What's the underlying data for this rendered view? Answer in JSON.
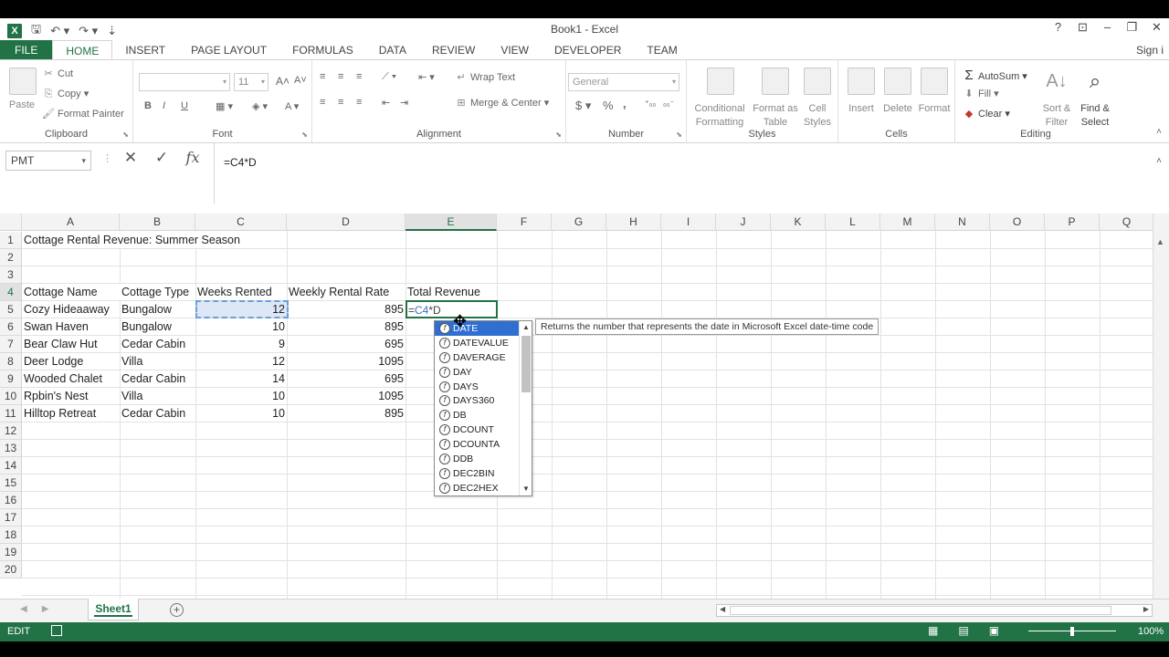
{
  "window": {
    "title": "Book1 - Excel",
    "sign_in": "Sign i",
    "help": "?",
    "minimize": "–",
    "restore": "❐",
    "close": "✕"
  },
  "ribbon_tabs": [
    "FILE",
    "HOME",
    "INSERT",
    "PAGE LAYOUT",
    "FORMULAS",
    "DATA",
    "REVIEW",
    "VIEW",
    "DEVELOPER",
    "TEAM"
  ],
  "active_tab": "HOME",
  "ribbon": {
    "clipboard": {
      "label": "Clipboard",
      "paste": "Paste",
      "cut": "Cut",
      "copy": "Copy",
      "format_painter": "Format Painter"
    },
    "font": {
      "label": "Font",
      "font_size": "11",
      "bold": "B",
      "italic": "I",
      "underline": "U",
      "font_grow": "A",
      "font_shrink": "A"
    },
    "alignment": {
      "label": "Alignment",
      "wrap_text": "Wrap Text",
      "merge_center": "Merge & Center"
    },
    "number": {
      "label": "Number",
      "format": "General",
      "currency": "$",
      "percent": "%",
      "comma": ","
    },
    "styles": {
      "label": "Styles",
      "conditional": "Conditional Formatting",
      "format_table": "Format as Table",
      "cell_styles": "Cell Styles"
    },
    "cells": {
      "label": "Cells",
      "insert": "Insert",
      "delete": "Delete",
      "format": "Format"
    },
    "editing": {
      "label": "Editing",
      "autosum": "AutoSum",
      "fill": "Fill",
      "clear": "Clear",
      "sort_filter": "Sort & Filter",
      "find_select": "Find & Select"
    }
  },
  "formula_bar": {
    "name_box": "PMT",
    "cancel": "✕",
    "enter": "✓",
    "fx": "fx",
    "formula": "=C4*D"
  },
  "columns": [
    "A",
    "B",
    "C",
    "D",
    "E",
    "F",
    "G",
    "H",
    "I",
    "J",
    "K",
    "L",
    "M",
    "N",
    "O",
    "P",
    "Q"
  ],
  "rows": [
    "1",
    "2",
    "3",
    "4",
    "5",
    "6",
    "7",
    "8",
    "9",
    "10",
    "11",
    "12",
    "13",
    "14",
    "15",
    "16",
    "17",
    "18",
    "19",
    "20"
  ],
  "sheet": {
    "title": "Cottage Rental Revenue: Summer Season",
    "headers": [
      "Cottage Name",
      "Cottage Type",
      "Weeks Rented",
      "Weekly Rental Rate",
      "Total Revenue"
    ],
    "data": [
      [
        "Cozy Hideaaway",
        "Bungalow",
        "12",
        "895"
      ],
      [
        "Swan Haven",
        "Bungalow",
        "10",
        "895"
      ],
      [
        "Bear Claw Hut",
        "Cedar Cabin",
        "9",
        "695"
      ],
      [
        "Deer Lodge",
        "Villa",
        "12",
        "1095"
      ],
      [
        "Wooded Chalet",
        "Cedar Cabin",
        "14",
        "695"
      ],
      [
        "Rpbin's Nest",
        "Villa",
        "10",
        "1095"
      ],
      [
        "Hilltop Retreat",
        "Cedar Cabin",
        "10",
        "895"
      ]
    ],
    "editing_cell": {
      "prefix": "=",
      "ref": "C4",
      "suffix": "*D"
    }
  },
  "autocomplete": {
    "items": [
      "DATE",
      "DATEVALUE",
      "DAVERAGE",
      "DAY",
      "DAYS",
      "DAYS360",
      "DB",
      "DCOUNT",
      "DCOUNTA",
      "DDB",
      "DEC2BIN",
      "DEC2HEX"
    ],
    "selected": "DATE",
    "tooltip": "Returns the number that represents the date in Microsoft Excel date-time code"
  },
  "sheet_tabs": {
    "active": "Sheet1",
    "add": "+"
  },
  "status": {
    "mode": "EDIT",
    "zoom": "100%"
  }
}
